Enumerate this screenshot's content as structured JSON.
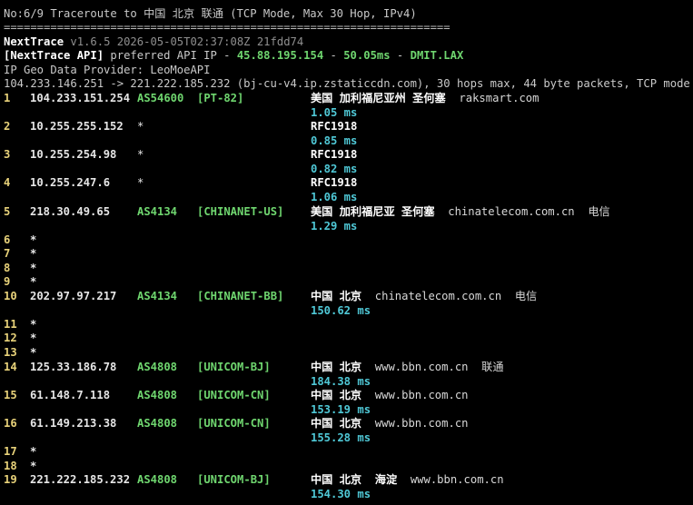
{
  "header": {
    "title": "No:6/9 Traceroute to 中国 北京 联通 (TCP Mode, Max 30 Hop, IPv4)",
    "separator": "==================================================================="
  },
  "nexttrace": {
    "name": "NextTrace",
    "version": "v1.6.5 2026-05-05T02:37:08Z 21fdd74"
  },
  "api": {
    "label": "[NextTrace API]",
    "text": " preferred API IP - ",
    "ip": "45.88.195.154",
    "dash": " - ",
    "latency": "50.05ms",
    "dash2": " - ",
    "node": "DMIT.LAX"
  },
  "geo_provider": "IP Geo Data Provider: LeoMoeAPI",
  "route_line": "104.233.146.251 -> 221.222.185.232 (bj-cu-v4.ip.zstaticcdn.com), 30 hops max, 44 byte packets, TCP mode",
  "hops": [
    {
      "num": "1",
      "ip": "104.233.151.254",
      "as": "AS54600",
      "tag": "[PT-82]",
      "geo": "美国 加利福尼亚州 圣何塞",
      "domain": "raksmart.com",
      "isp": "",
      "rtt": "1.05 ms"
    },
    {
      "num": "2",
      "ip": "10.255.255.152",
      "as": "*",
      "tag": "",
      "geo": "RFC1918",
      "domain": "",
      "isp": "",
      "rtt": "0.85 ms"
    },
    {
      "num": "3",
      "ip": "10.255.254.98",
      "as": "*",
      "tag": "",
      "geo": "RFC1918",
      "domain": "",
      "isp": "",
      "rtt": "0.82 ms"
    },
    {
      "num": "4",
      "ip": "10.255.247.6",
      "as": "*",
      "tag": "",
      "geo": "RFC1918",
      "domain": "",
      "isp": "",
      "rtt": "1.06 ms"
    },
    {
      "num": "5",
      "ip": "218.30.49.65",
      "as": "AS4134",
      "tag": "[CHINANET-US]",
      "geo": "美国 加利福尼亚 圣何塞",
      "domain": "chinatelecom.com.cn",
      "isp": "电信",
      "rtt": "1.29 ms"
    },
    {
      "num": "6",
      "ip": "*"
    },
    {
      "num": "7",
      "ip": "*"
    },
    {
      "num": "8",
      "ip": "*"
    },
    {
      "num": "9",
      "ip": "*"
    },
    {
      "num": "10",
      "ip": "202.97.97.217",
      "as": "AS4134",
      "tag": "[CHINANET-BB]",
      "geo": "中国 北京",
      "domain": "chinatelecom.com.cn",
      "isp": "电信",
      "rtt": "150.62 ms"
    },
    {
      "num": "11",
      "ip": "*"
    },
    {
      "num": "12",
      "ip": "*"
    },
    {
      "num": "13",
      "ip": "*"
    },
    {
      "num": "14",
      "ip": "125.33.186.78",
      "as": "AS4808",
      "tag": "[UNICOM-BJ]",
      "geo": "中国 北京",
      "domain": "www.bbn.com.cn",
      "isp": "联通",
      "rtt": "184.38 ms"
    },
    {
      "num": "15",
      "ip": "61.148.7.118",
      "as": "AS4808",
      "tag": "[UNICOM-CN]",
      "geo": "中国 北京",
      "domain": "www.bbn.com.cn",
      "isp": "",
      "rtt": "153.19 ms"
    },
    {
      "num": "16",
      "ip": "61.149.213.38",
      "as": "AS4808",
      "tag": "[UNICOM-CN]",
      "geo": "中国 北京",
      "domain": "www.bbn.com.cn",
      "isp": "",
      "rtt": "155.28 ms"
    },
    {
      "num": "17",
      "ip": "*"
    },
    {
      "num": "18",
      "ip": "*"
    },
    {
      "num": "19",
      "ip": "221.222.185.232",
      "as": "AS4808",
      "tag": "[UNICOM-BJ]",
      "geo": "中国 北京  海淀",
      "domain": "www.bbn.com.cn",
      "isp": "",
      "rtt": "154.30 ms"
    }
  ],
  "colors": {
    "background": "#000000",
    "hop_number": "#e8d27a",
    "asn": "#6fd66f",
    "rtt": "#4fc8d6",
    "text": "#d9d9d9"
  }
}
